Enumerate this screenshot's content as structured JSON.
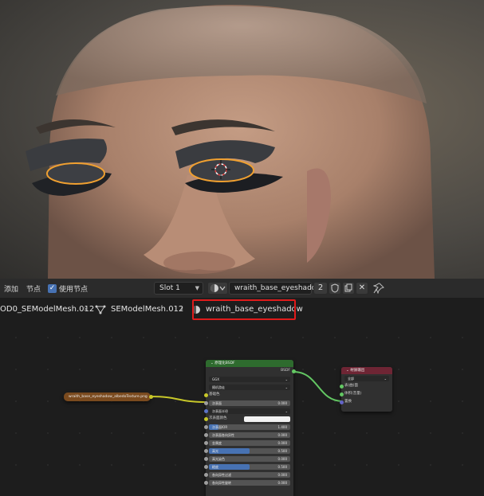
{
  "header": {
    "menu_add": "添加",
    "menu_node": "节点",
    "use_nodes_label": "使用节点",
    "slot_value": "Slot 1",
    "material_name": "wraith_base_eyeshadow",
    "user_count": "2"
  },
  "breadcrumb": {
    "object_name": "OD0_SEModelMesh.012",
    "mesh_name": "SEModelMesh.012",
    "material_name": "wraith_base_eyeshadow"
  },
  "image_node": {
    "label": "wraith_base_eyeshadow_albedoTexture.png",
    "color": "#7a4a1e"
  },
  "bsdf_node": {
    "title": "原理化BSDF",
    "output_label": "BSDF",
    "distribution": "GGX",
    "subsurface_method": "随机游走",
    "base_color_label": "基础色",
    "rows": [
      {
        "label": "次表面",
        "value": "0.000",
        "fill": 0
      },
      {
        "label": "次表面半径",
        "value": "",
        "fill": 0,
        "dropdown": true
      },
      {
        "label": "次表面颜色",
        "value": "",
        "fill": 0,
        "color": true
      },
      {
        "label": "次表面IOR",
        "value": "1.400",
        "fill": 0.12
      },
      {
        "label": "次表面各向异性",
        "value": "0.000",
        "fill": 0
      },
      {
        "label": "金属度",
        "value": "0.000",
        "fill": 0
      },
      {
        "label": "高光",
        "value": "0.500",
        "fill": 0.5
      },
      {
        "label": "高光染色",
        "value": "0.000",
        "fill": 0
      },
      {
        "label": "糙度",
        "value": "0.500",
        "fill": 0.5
      },
      {
        "label": "各向异性过滤",
        "value": "0.000",
        "fill": 0
      },
      {
        "label": "各向异性旋转",
        "value": "0.000",
        "fill": 0
      }
    ],
    "header_color": "#2e6b2e"
  },
  "output_node": {
    "title": "材质输出",
    "target": "全部",
    "sockets": [
      "表(曲)面",
      "体积(音量)",
      "置换"
    ],
    "header_color": "#6e2534"
  },
  "colors": {
    "highlight_box": "#e01b1b",
    "checkbox": "#4772b3",
    "wire_yellow": "#c7c729",
    "wire_green": "#63c763"
  }
}
